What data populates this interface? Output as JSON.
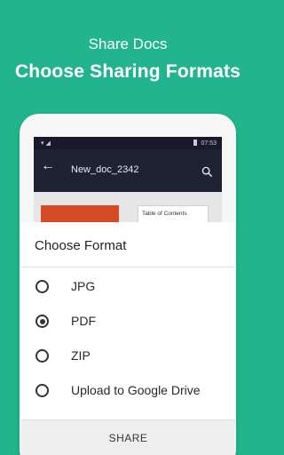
{
  "promo": {
    "subtitle": "Share Docs",
    "title": "Choose Sharing Formats"
  },
  "status_bar": {
    "time": "07:53",
    "left_icons": "▾ ◢"
  },
  "app_bar": {
    "title": "New_doc_2342"
  },
  "document": {
    "toc_label": "Table of Contents"
  },
  "sheet": {
    "title": "Choose Format",
    "options": [
      {
        "label": "JPG",
        "selected": false
      },
      {
        "label": "PDF",
        "selected": true
      },
      {
        "label": "ZIP",
        "selected": false
      },
      {
        "label": "Upload to Google Drive",
        "selected": false
      }
    ],
    "share_label": "SHARE"
  },
  "colors": {
    "background": "#22b48f",
    "app_bar": "#1f2233",
    "thumbnail": "#d64a25"
  },
  "icons": [
    "back-arrow-icon",
    "search-icon",
    "wifi-icon",
    "signal-icon",
    "battery-icon"
  ]
}
